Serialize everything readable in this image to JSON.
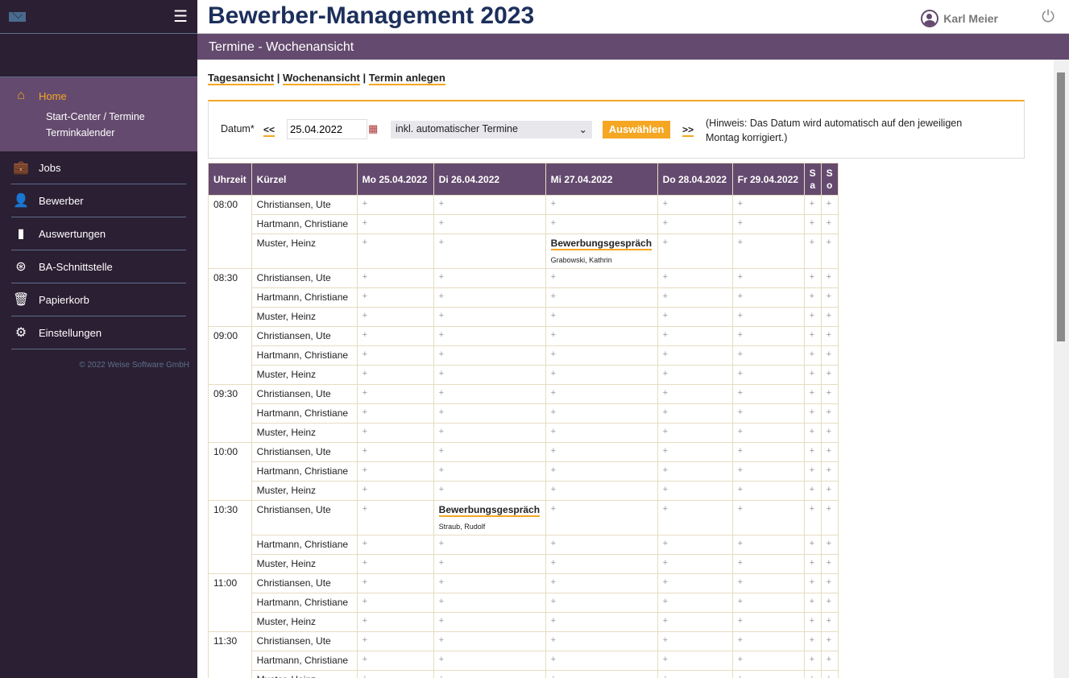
{
  "sidebar": {
    "home": "Home",
    "subitems": [
      "Start-Center / Termine",
      "Terminkalender"
    ],
    "items": [
      {
        "label": "Jobs",
        "icon": "briefcase-icon"
      },
      {
        "label": "Bewerber",
        "icon": "person-icon"
      },
      {
        "label": "Auswertungen",
        "icon": "bar-chart-icon"
      },
      {
        "label": "BA-Schnittstelle",
        "icon": "ba-icon"
      },
      {
        "label": "Papierkorb",
        "icon": "trash-icon"
      },
      {
        "label": "Einstellungen",
        "icon": "gear-icon"
      }
    ],
    "copyright": "© 2022 Weise Software GmbH"
  },
  "header": {
    "title": "Bewerber-Management 2023",
    "user": "Karl Meier"
  },
  "page_title": "Termine - Wochenansicht",
  "links": [
    "Tagesansicht",
    "Wochenansicht",
    "Termin anlegen"
  ],
  "form": {
    "label": "Datum*",
    "prev": "<<",
    "date": "25.04.2022",
    "filter": "inkl. automatischer Termine",
    "submit": "Auswählen",
    "next": ">>",
    "hint1": "(Hinweis: Das Datum wird automatisch auf den jeweiligen",
    "hint2": "Montag korrigiert.)"
  },
  "table": {
    "headers": [
      "Uhrzeit",
      "Kürzel",
      "Mo 25.04.2022",
      "Di 26.04.2022",
      "Mi 27.04.2022",
      "Do 28.04.2022",
      "Fr 29.04.2022",
      "Sa",
      "So"
    ],
    "times": [
      "08:00",
      "08:30",
      "09:00",
      "09:30",
      "10:00",
      "10:30",
      "11:00",
      "11:30"
    ],
    "people": [
      "Christiansen, Ute",
      "Hartmann, Christiane",
      "Muster, Heinz"
    ],
    "add": "+",
    "appointments": [
      {
        "time": "08:00",
        "person": 2,
        "day": 2,
        "title": "Bewerbungsgespräch",
        "name": "Grabowski, Kathrin"
      },
      {
        "time": "10:30",
        "person": 0,
        "day": 1,
        "title": "Bewerbungsgespräch",
        "name": "Straub, Rudolf"
      }
    ]
  },
  "colors": {
    "accent": "#f5a623",
    "purple": "#644a6e",
    "sidebar": "#2b1f33"
  }
}
